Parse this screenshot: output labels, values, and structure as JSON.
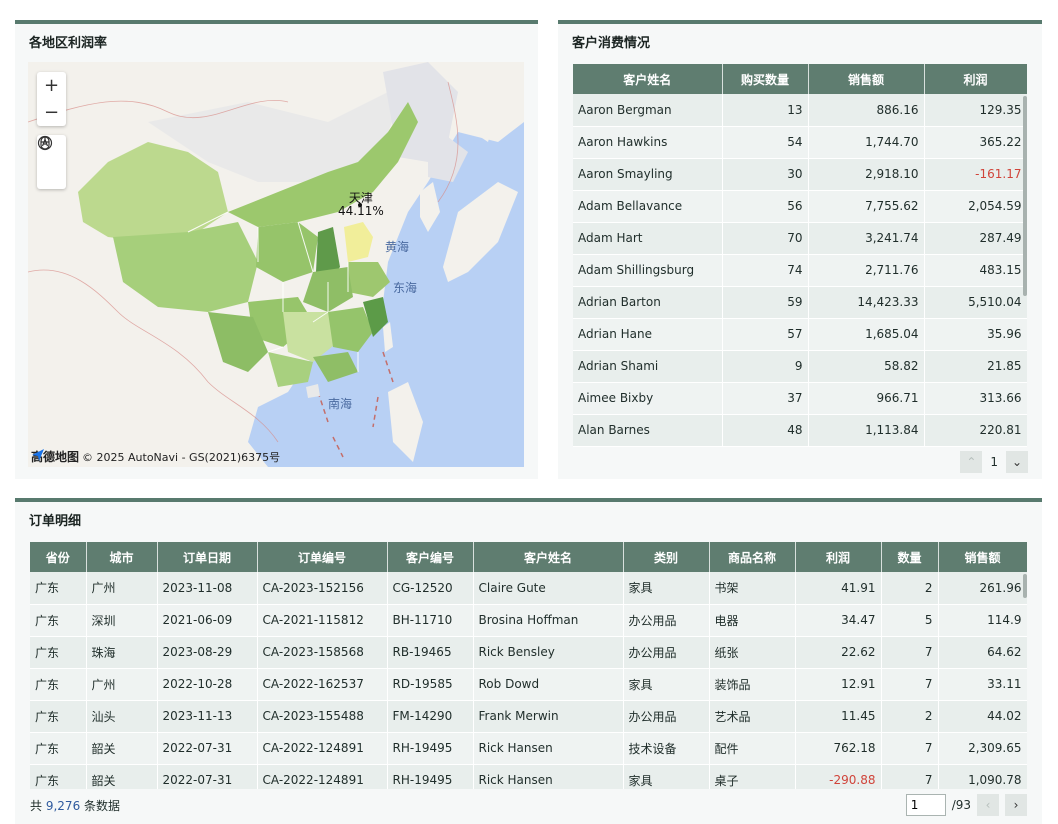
{
  "map_panel": {
    "title": "各地区利润率",
    "zoom_in": "+",
    "zoom_out": "−",
    "tooltip_region": "天津",
    "tooltip_value": "44.11%",
    "sea_labels": {
      "yellow_sea": "黄海",
      "east_sea": "东海",
      "south_sea": "南海"
    },
    "attribution_logo": "高德地图",
    "attribution_text": "© 2025 AutoNavi - GS(2021)6375号"
  },
  "customer_panel": {
    "title": "客户消费情况",
    "columns": [
      "客户姓名",
      "购买数量",
      "销售额",
      "利润"
    ],
    "rows": [
      [
        "Aaron Bergman",
        "13",
        "886.16",
        "129.35"
      ],
      [
        "Aaron Hawkins",
        "54",
        "1,744.70",
        "365.22"
      ],
      [
        "Aaron Smayling",
        "30",
        "2,918.10",
        "-161.17"
      ],
      [
        "Adam Bellavance",
        "56",
        "7,755.62",
        "2,054.59"
      ],
      [
        "Adam Hart",
        "70",
        "3,241.74",
        "287.49"
      ],
      [
        "Adam Shillingsburg",
        "74",
        "2,711.76",
        "483.15"
      ],
      [
        "Adrian Barton",
        "59",
        "14,423.33",
        "5,510.04"
      ],
      [
        "Adrian Hane",
        "57",
        "1,685.04",
        "35.96"
      ],
      [
        "Adrian Shami",
        "9",
        "58.82",
        "21.85"
      ],
      [
        "Aimee Bixby",
        "37",
        "966.71",
        "313.66"
      ],
      [
        "Alan Barnes",
        "48",
        "1,113.84",
        "220.81"
      ]
    ],
    "page": "1"
  },
  "order_panel": {
    "title": "订单明细",
    "columns": [
      "省份",
      "城市",
      "订单日期",
      "订单编号",
      "客户编号",
      "客户姓名",
      "类别",
      "商品名称",
      "利润",
      "数量",
      "销售额"
    ],
    "rows": [
      [
        "广东",
        "广州",
        "2023-11-08",
        "CA-2023-152156",
        "CG-12520",
        "Claire Gute",
        "家具",
        "书架",
        "41.91",
        "2",
        "261.96"
      ],
      [
        "广东",
        "深圳",
        "2021-06-09",
        "CA-2021-115812",
        "BH-11710",
        "Brosina Hoffman",
        "办公用品",
        "电器",
        "34.47",
        "5",
        "114.9"
      ],
      [
        "广东",
        "珠海",
        "2023-08-29",
        "CA-2023-158568",
        "RB-19465",
        "Rick Bensley",
        "办公用品",
        "纸张",
        "22.62",
        "7",
        "64.62"
      ],
      [
        "广东",
        "广州",
        "2022-10-28",
        "CA-2022-162537",
        "RD-19585",
        "Rob Dowd",
        "家具",
        "装饰品",
        "12.91",
        "7",
        "33.11"
      ],
      [
        "广东",
        "汕头",
        "2023-11-13",
        "CA-2023-155488",
        "FM-14290",
        "Frank Merwin",
        "办公用品",
        "艺术品",
        "11.45",
        "2",
        "44.02"
      ],
      [
        "广东",
        "韶关",
        "2022-07-31",
        "CA-2022-124891",
        "RH-19495",
        "Rick Hansen",
        "技术设备",
        "配件",
        "762.18",
        "7",
        "2,309.65"
      ],
      [
        "广东",
        "韶关",
        "2022-07-31",
        "CA-2022-124891",
        "RH-19495",
        "Rick Hansen",
        "家具",
        "桌子",
        "-290.88",
        "7",
        "1,090.78"
      ]
    ],
    "total_prefix": "共",
    "total_count": "9,276",
    "total_suffix": "条数据",
    "page_value": "1",
    "page_total": "/93"
  },
  "colors": {
    "accent": "#587a6e",
    "header": "#5f7d70",
    "negative": "#d0443a"
  }
}
